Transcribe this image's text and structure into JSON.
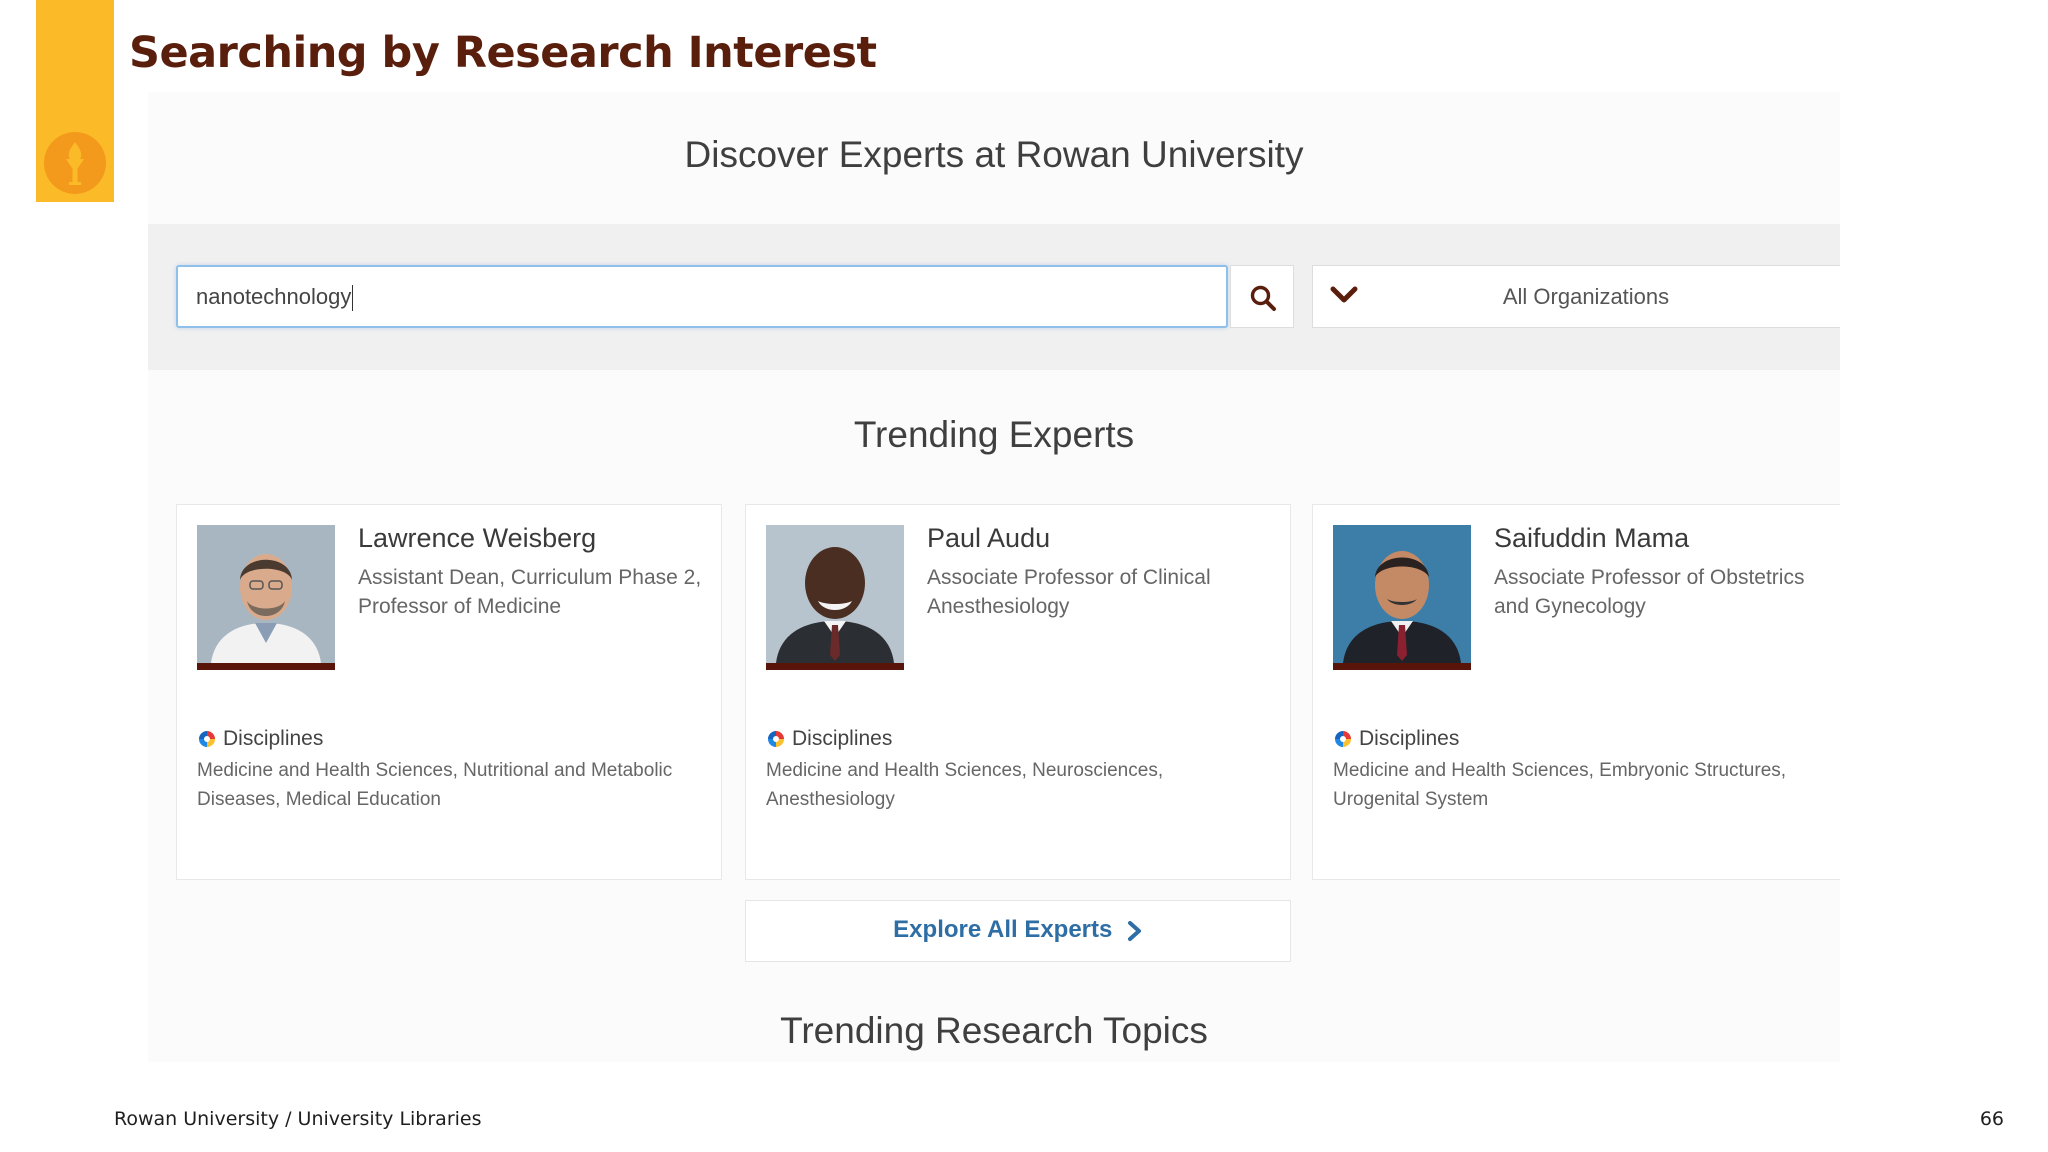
{
  "slide": {
    "title": "Searching by Research Interest",
    "footer_left": "Rowan University / University Libraries",
    "page_number": "66",
    "accent_color": "#FBBA27",
    "title_color": "#5A1E0D"
  },
  "portal": {
    "heading": "Discover Experts at Rowan University",
    "search": {
      "value": "nanotechnology",
      "icon": "search-icon"
    },
    "org_filter": {
      "selected": "All Organizations",
      "icon": "chevron-down-icon"
    },
    "trending_heading": "Trending Experts",
    "experts": [
      {
        "name": "Lawrence Weisberg",
        "title": "Assistant Dean, Curriculum Phase 2, Professor of Medicine",
        "disciplines_label": "Disciplines",
        "disciplines": "Medicine and Health Sciences, Nutritional and Metabolic Diseases, Medical Education"
      },
      {
        "name": "Paul Audu",
        "title": "Associate Professor of Clinical Anesthesiology",
        "disciplines_label": "Disciplines",
        "disciplines": "Medicine and Health Sciences, Neurosciences, Anesthesiology"
      },
      {
        "name": "Saifuddin Mama",
        "title": "Associate Professor of Obstetrics and Gynecology",
        "disciplines_label": "Disciplines",
        "disciplines": "Medicine and Health Sciences, Embryonic Structures, Urogenital System"
      }
    ],
    "explore_button": "Explore All Experts",
    "topics_heading": "Trending Research Topics"
  }
}
